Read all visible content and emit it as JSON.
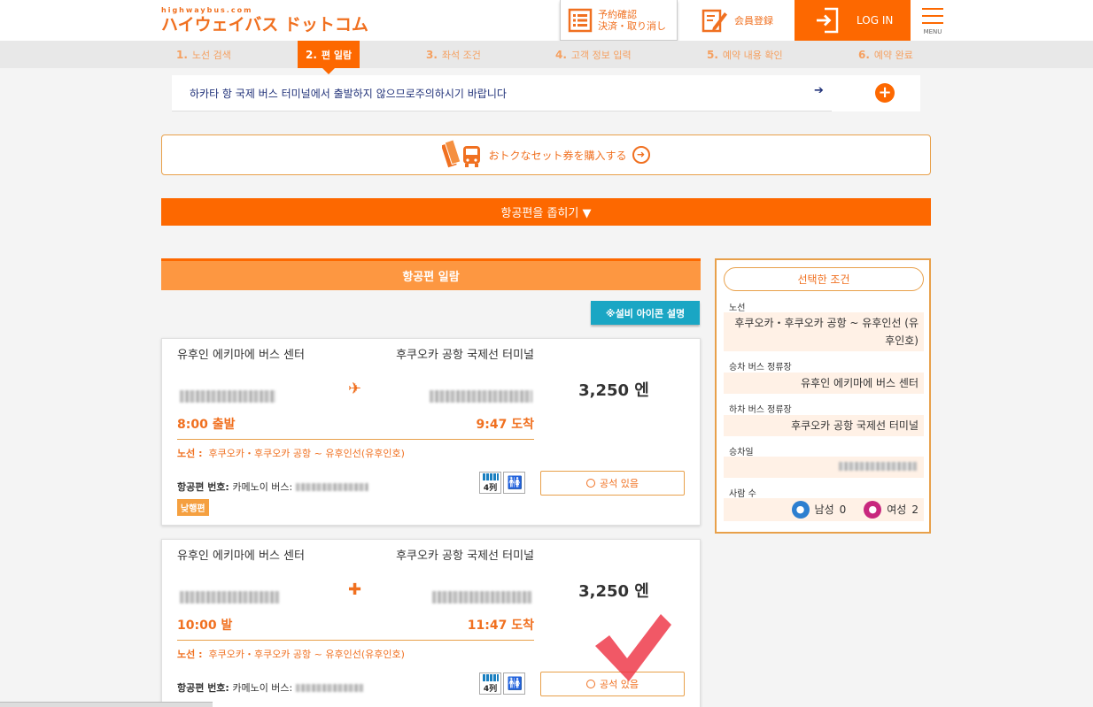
{
  "header": {
    "logo_small": "highwaybus.com",
    "logo_main": "ハイウェイバス ドットコム",
    "reserve_line1": "予約確認",
    "reserve_line2": "決済・取り消し",
    "member_label": "会員登録",
    "login_label": "LOG IN",
    "menu_label": "MENU"
  },
  "steps": [
    {
      "num": "1.",
      "label": "노선 검색",
      "active": false
    },
    {
      "num": "2.",
      "label": "편 일람",
      "active": true
    },
    {
      "num": "3.",
      "label": "좌석 조건",
      "active": false
    },
    {
      "num": "4.",
      "label": "고객 정보 입력",
      "active": false
    },
    {
      "num": "5.",
      "label": "예약 내용 확인",
      "active": false
    },
    {
      "num": "6.",
      "label": "예약 완료",
      "active": false
    }
  ],
  "notice": {
    "text": "하카타 항 국제 버스 터미널에서 출발하지 않으므로주의하시기 바랍니다",
    "arrow": "➔",
    "plus": "+"
  },
  "set_ticket": {
    "label": "おトクなセット券を購入する",
    "arrow": "➜"
  },
  "filter": {
    "label": "항공편을 좁히기 ▼"
  },
  "list": {
    "title": "항공편 일람",
    "equip_button": "※설비 아이콘 설명"
  },
  "cards": [
    {
      "from": "유후인 에키마에 버스 센터",
      "to": "후쿠오카 공항 국제선 터미널",
      "departure": "8:00 출발",
      "arrival": "9:47 도착",
      "price": "3,250 엔",
      "route_label": "노선 :",
      "route": "후쿠오카・후쿠오카 공항 ~ 유후인선(유후인호)",
      "flight_label": "항공편 번호:",
      "flight": "카메노이 버스:",
      "day_tag": "낮행편",
      "seats_icon": "4列",
      "seat_status": "공석 있음"
    },
    {
      "from": "유후인 에키마에 버스 센터",
      "to": "후쿠오카 공항 국제선 터미널",
      "departure": "10:00 발",
      "arrival": "11:47 도착",
      "price": "3,250 엔",
      "route_label": "노선 :",
      "route": "후쿠오카・후쿠오카 공항 ~ 유후인선(유후인호)",
      "flight_label": "항공편 번호:",
      "flight": "카메노이 버스:",
      "seats_icon": "4列",
      "seat_status": "공석 있음"
    }
  ],
  "panel": {
    "title": "선택한 조건",
    "route_label": "노선",
    "route_value": "후쿠오카・후쿠오카 공항 ~ 유후인선 (유후인호)",
    "board_label": "승차 버스 정류장",
    "board_value": "유후인 에키마에 버스 센터",
    "alight_label": "하차 버스 정류장",
    "alight_value": "후쿠오카 공항 국제선 터미널",
    "date_label": "승차일",
    "people_label": "사람 수",
    "male_label": "남성",
    "male_count": "0",
    "female_label": "여성",
    "female_count": "2"
  },
  "colors": {
    "brand_orange": "#fd6800",
    "light_orange": "#fd9741",
    "teal": "#1aa6c4",
    "navy": "#22337a",
    "check_red": "#ee3344"
  }
}
